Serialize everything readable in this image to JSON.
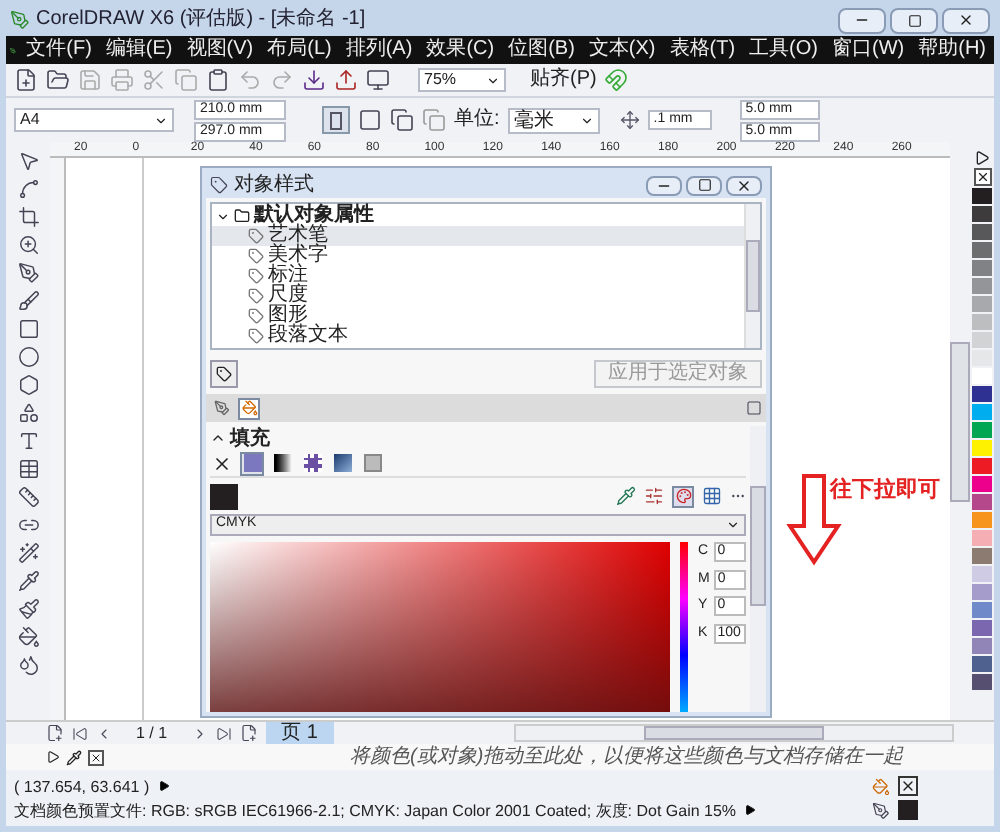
{
  "window": {
    "title": "CorelDRAW X6 (评估版) - [未命名 -1]"
  },
  "menu": [
    "文件(F)",
    "编辑(E)",
    "视图(V)",
    "布局(L)",
    "排列(A)",
    "效果(C)",
    "位图(B)",
    "文本(X)",
    "表格(T)",
    "工具(O)",
    "窗口(W)",
    "帮助(H)"
  ],
  "toolbar": {
    "zoom": "75%",
    "snap": "贴齐(P)"
  },
  "property_bar": {
    "page_size": "A4",
    "width": "210.0 mm",
    "height": "297.0 mm",
    "units_label": "单位:",
    "units": "毫米",
    "nudge": ".1 mm",
    "duplicate_x": "5.0 mm",
    "duplicate_y": "5.0 mm"
  },
  "ruler": [
    "20",
    "0",
    "20",
    "40",
    "60",
    "80",
    "100",
    "120",
    "140",
    "160",
    "180",
    "200",
    "220",
    "240",
    "260"
  ],
  "docker": {
    "title": "对象样式",
    "tree": {
      "label": "默认对象属性",
      "expanded": true,
      "children": [
        {
          "label": "艺术笔",
          "selected": true
        },
        {
          "label": "美术字",
          "selected": false
        },
        {
          "label": "标注",
          "selected": false
        },
        {
          "label": "尺度",
          "selected": false
        },
        {
          "label": "图形",
          "selected": false
        },
        {
          "label": "段落文本",
          "selected": false
        }
      ]
    },
    "apply_button": {
      "label": "应用于选定对象",
      "disabled": true
    },
    "tabs": [
      {
        "kind": "outline",
        "selected": false
      },
      {
        "kind": "fill",
        "selected": true
      }
    ],
    "fill": {
      "title": "填充",
      "expanded": true,
      "types": [
        {
          "kind": "none",
          "selected": false
        },
        {
          "kind": "uniform",
          "selected": true
        },
        {
          "kind": "fountain",
          "selected": false
        },
        {
          "kind": "pattern",
          "selected": false
        },
        {
          "kind": "texture",
          "selected": false
        },
        {
          "kind": "postscript",
          "selected": false
        }
      ],
      "model": "CMYK",
      "values": [
        {
          "label": "C",
          "value": "0"
        },
        {
          "label": "M",
          "value": "0"
        },
        {
          "label": "Y",
          "value": "0"
        },
        {
          "label": "K",
          "value": "100"
        }
      ]
    }
  },
  "annotation": {
    "text": "往下拉即可"
  },
  "page_nav": {
    "counter": "1 / 1",
    "tabs": [
      {
        "label": "页 1",
        "selected": true
      }
    ]
  },
  "palette_hint": "将颜色(或对象)拖动至此处，以便将这些颜色与文档存储在一起",
  "status": {
    "coordinates": "( 137.654, 63.641 )",
    "profile": "文档颜色预置文件: RGB: sRGB IEC61966-2.1; CMYK: Japan Color 2001 Coated; 灰度: Dot Gain 15%"
  },
  "palette": [
    {
      "color": "#231f20"
    },
    {
      "color": "#3d3b3c"
    },
    {
      "color": "#58585a"
    },
    {
      "color": "#6d6e70"
    },
    {
      "color": "#808285"
    },
    {
      "color": "#939598"
    },
    {
      "color": "#a7a9ac"
    },
    {
      "color": "#bcbec0"
    },
    {
      "color": "#d1d3d4"
    },
    {
      "color": "#e6e7e8"
    },
    {
      "color": "#ffffff"
    },
    {
      "color": "#2e3192"
    },
    {
      "color": "#00aeef"
    },
    {
      "color": "#00a651"
    },
    {
      "color": "#fff200"
    },
    {
      "color": "#ed1c24"
    },
    {
      "color": "#ec008c"
    },
    {
      "color": "#b5478b"
    },
    {
      "color": "#f7941d"
    },
    {
      "color": "#f5aeb4"
    },
    {
      "color": "#8c7b70"
    },
    {
      "color": "#d0cbe4"
    },
    {
      "color": "#a69ccb"
    },
    {
      "color": "#7089c9"
    },
    {
      "color": "#7a67b0"
    },
    {
      "color": "#9184b6"
    },
    {
      "color": "#4f618f"
    },
    {
      "color": "#574f70"
    }
  ]
}
